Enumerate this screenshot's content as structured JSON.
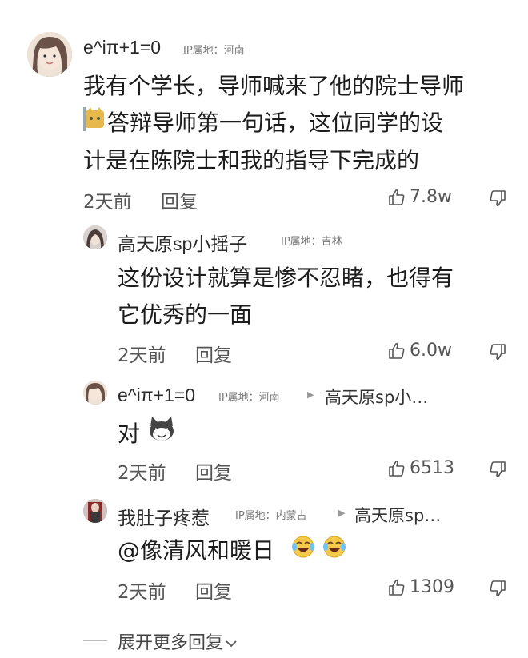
{
  "comments": [
    {
      "username": "e^iπ+1=0",
      "ip_label": "IP属地：河南",
      "lines": [
        "我有个学长，导师喊来了他的院士导师",
        "答辩导师第一句话，这位同学的设",
        "计是在陈院士和我的指导下完成的"
      ],
      "time": "2天前",
      "reply_label": "回复",
      "likes": "7.8w"
    },
    {
      "username": "高天原sp小摇子",
      "ip_label": "IP属地：吉林",
      "lines": [
        "这份设计就算是惨不忍睹，也得有",
        "它优秀的一面"
      ],
      "time": "2天前",
      "reply_label": "回复",
      "likes": "6.0w"
    },
    {
      "username": "e^iπ+1=0",
      "ip_label": "IP属地：河南",
      "reply_to": "高天原sp小…",
      "lines": [
        "对"
      ],
      "time": "2天前",
      "reply_label": "回复",
      "likes": "6513"
    },
    {
      "username": "我肚子疼惹",
      "ip_label": "IP属地：内蒙古",
      "reply_to": "高天原sp…",
      "lines": [
        "@像清风和暖日"
      ],
      "time": "2天前",
      "reply_label": "回复",
      "likes": "1309"
    }
  ],
  "expand_more": "展开更多回复",
  "icons": [
    "thumbs-up-icon",
    "thumbs-down-icon",
    "chevron-down-icon",
    "cat-emoji-icon",
    "laughing-cat-emoji-icon",
    "tears-of-joy-emoji-icon"
  ]
}
